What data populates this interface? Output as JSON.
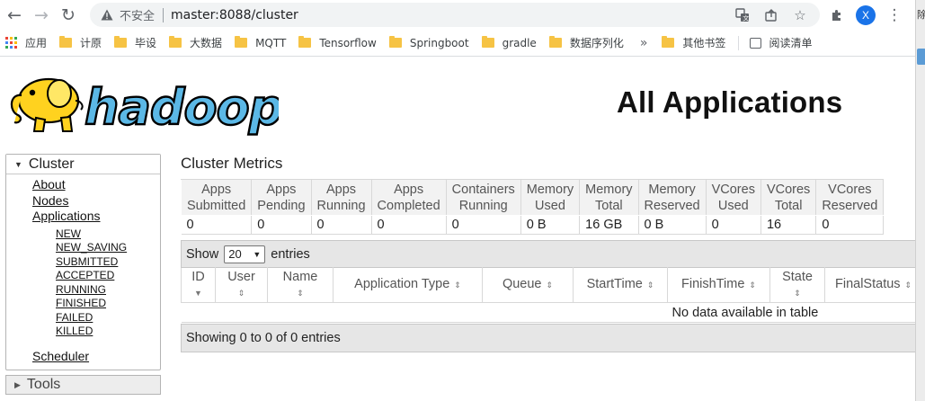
{
  "browser": {
    "insecure_label": "不安全",
    "url": "master:8088/cluster",
    "avatar_letter": "X",
    "bookmarks": [
      "应用",
      "计原",
      "毕设",
      "大数据",
      "MQTT",
      "Tensorflow",
      "Springboot",
      "gradle",
      "数据序列化"
    ],
    "more": "»",
    "other_bookmarks": "其他书签",
    "reading_list": "阅读清单",
    "side_strip_text": "除"
  },
  "page": {
    "title": "All Applications",
    "logo_text": "hadoop"
  },
  "nav": {
    "cluster_label": "Cluster",
    "links": [
      "About",
      "Nodes",
      "Applications"
    ],
    "app_states": [
      "NEW",
      "NEW_SAVING",
      "SUBMITTED",
      "ACCEPTED",
      "RUNNING",
      "FINISHED",
      "FAILED",
      "KILLED"
    ],
    "scheduler": "Scheduler",
    "tools_label": "Tools"
  },
  "metrics": {
    "title": "Cluster Metrics",
    "headers": [
      [
        "Apps",
        "Submitted"
      ],
      [
        "Apps",
        "Pending"
      ],
      [
        "Apps",
        "Running"
      ],
      [
        "Apps",
        "Completed"
      ],
      [
        "Containers",
        "Running"
      ],
      [
        "Memory",
        "Used"
      ],
      [
        "Memory",
        "Total"
      ],
      [
        "Memory",
        "Reserved"
      ],
      [
        "VCores",
        "Used"
      ],
      [
        "VCores",
        "Total"
      ],
      [
        "VCores",
        "Reserved"
      ]
    ],
    "values": [
      "0",
      "0",
      "0",
      "0",
      "0",
      "0 B",
      "16 GB",
      "0 B",
      "0",
      "16",
      "0"
    ]
  },
  "apps_table": {
    "show_label": "Show",
    "page_size": "20",
    "entries_label": "entries",
    "columns": [
      "ID",
      "User",
      "Name",
      "Application Type",
      "Queue",
      "StartTime",
      "FinishTime",
      "State",
      "FinalStatus"
    ],
    "empty_message": "No data available in table",
    "footer": "Showing 0 to 0 of 0 entries"
  },
  "colors": {
    "logo_blue": "#5bb8e6",
    "logo_yellow": "#ffd21f",
    "header_gray": "#e6e6e6"
  }
}
